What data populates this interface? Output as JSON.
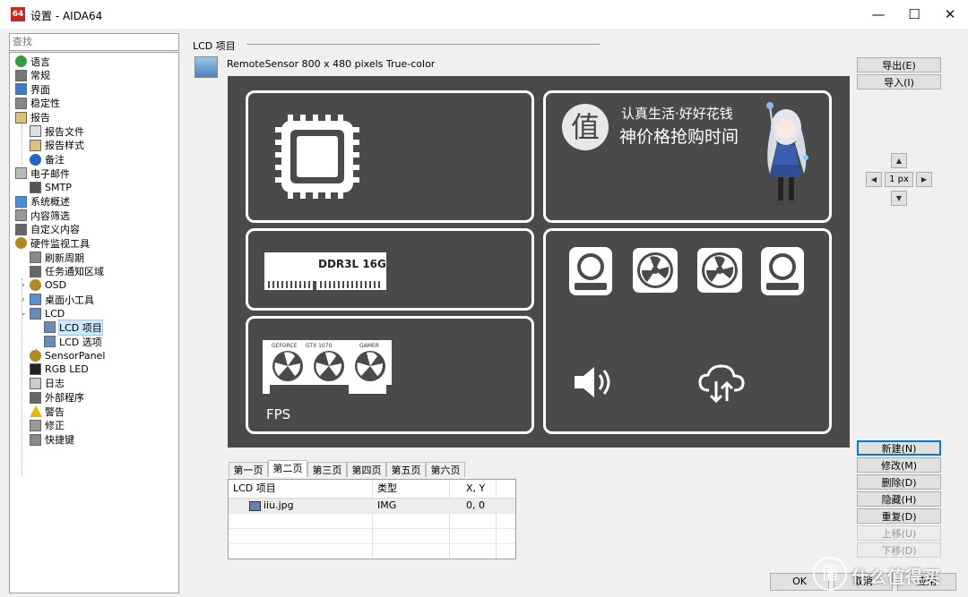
{
  "window": {
    "title": "设置 - AIDA64",
    "app_icon_text": "64",
    "minimize_glyph": "—",
    "maximize_glyph": "☐",
    "close_glyph": "✕"
  },
  "sidebar": {
    "search_placeholder": "查找",
    "items": [
      {
        "label": "语言",
        "icon": "globe-icon"
      },
      {
        "label": "常规",
        "icon": "gear-icon"
      },
      {
        "label": "界面",
        "icon": "monitor-icon"
      },
      {
        "label": "稳定性",
        "icon": "magnifier-icon"
      },
      {
        "label": "报告",
        "icon": "report-icon"
      },
      {
        "label": "报告文件",
        "icon": "file-icon"
      },
      {
        "label": "报告样式",
        "icon": "report-style-icon"
      },
      {
        "label": "备注",
        "icon": "info-icon"
      },
      {
        "label": "电子邮件",
        "icon": "mail-icon"
      },
      {
        "label": "SMTP",
        "icon": "smtp-icon"
      },
      {
        "label": "系统概述",
        "icon": "system-icon"
      },
      {
        "label": "内容筛选",
        "icon": "filter-icon"
      },
      {
        "label": "自定义内容",
        "icon": "custom-icon"
      },
      {
        "label": "硬件监视工具",
        "icon": "gauge-icon"
      },
      {
        "label": "刷新周期",
        "icon": "refresh-icon"
      },
      {
        "label": "任务通知区域",
        "icon": "tray-icon"
      },
      {
        "label": "OSD",
        "icon": "osd-icon"
      },
      {
        "label": "桌面小工具",
        "icon": "gadget-icon"
      },
      {
        "label": "LCD",
        "icon": "lcd-icon"
      },
      {
        "label": "LCD 项目",
        "icon": "lcd-item-icon"
      },
      {
        "label": "LCD 选项",
        "icon": "lcd-options-icon"
      },
      {
        "label": "SensorPanel",
        "icon": "sensorpanel-icon"
      },
      {
        "label": "RGB LED",
        "icon": "rgb-led-icon"
      },
      {
        "label": "日志",
        "icon": "log-icon"
      },
      {
        "label": "外部程序",
        "icon": "external-program-icon"
      },
      {
        "label": "警告",
        "icon": "warning-icon"
      },
      {
        "label": "修正",
        "icon": "correction-icon"
      },
      {
        "label": "快捷键",
        "icon": "keyboard-icon"
      }
    ]
  },
  "main": {
    "section_title": "LCD 项目",
    "sensor_label": "RemoteSensor 800 x 480 pixels True-color",
    "lcd": {
      "ram_label": "DDR3L 16G",
      "gpu_brand": "GEFORCE",
      "gpu_model": "GTX 1070",
      "gpu_series": "GAMER",
      "fps_label": "FPS",
      "banner_glyph": "值",
      "banner_line1": "认真生活·好好花钱",
      "banner_line2": "神价格抢购时间"
    },
    "right_buttons": {
      "export": "导出(E)",
      "import": "导入(I)"
    },
    "nudge": {
      "px_label": "1 px"
    },
    "action_buttons": [
      {
        "label": "新建(N)",
        "enabled": true
      },
      {
        "label": "修改(M)",
        "enabled": true
      },
      {
        "label": "删除(D)",
        "enabled": true
      },
      {
        "label": "隐藏(H)",
        "enabled": true
      },
      {
        "label": "重复(D)",
        "enabled": true
      },
      {
        "label": "上移(U)",
        "enabled": false
      },
      {
        "label": "下移(D)",
        "enabled": false
      }
    ],
    "tabs": [
      "第一页",
      "第二页",
      "第三页",
      "第四页",
      "第五页",
      "第六页"
    ],
    "active_tab": "第二页",
    "table": {
      "headers": [
        "LCD 项目",
        "类型",
        "X, Y"
      ],
      "rows": [
        {
          "name": "iiu.jpg",
          "type": "IMG",
          "xy": "0, 0"
        }
      ]
    }
  },
  "footer": {
    "ok": "OK",
    "cancel": "取消",
    "apply": "应用"
  },
  "watermark": {
    "glyph": "值",
    "text": "什么值得买"
  }
}
